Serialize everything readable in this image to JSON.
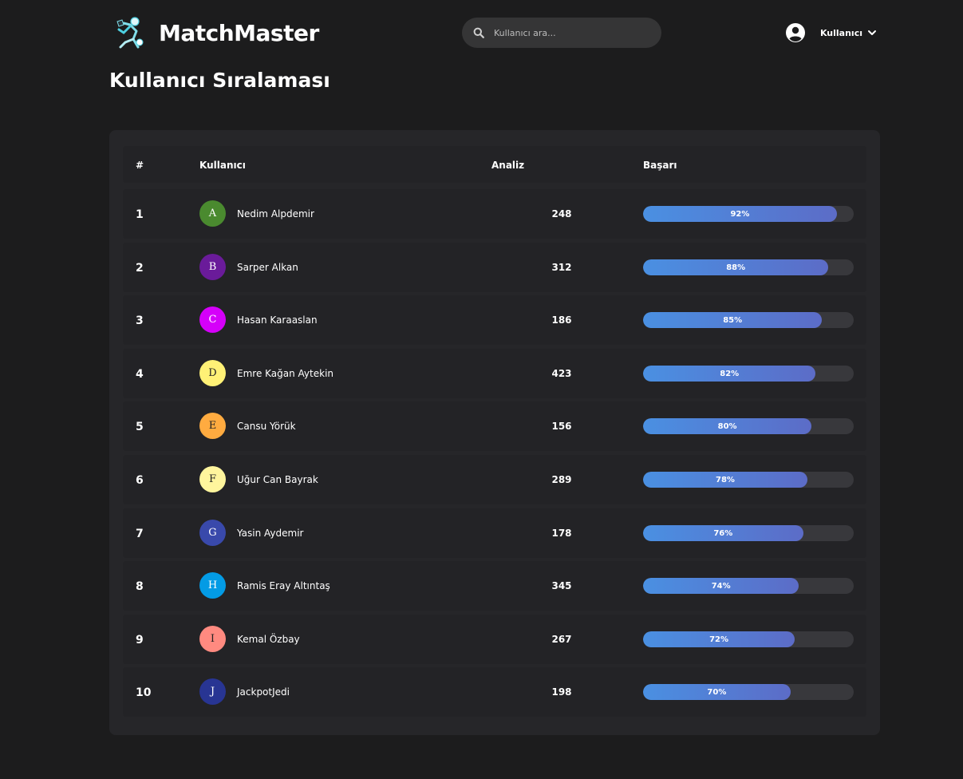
{
  "header": {
    "brand": "MatchMaster",
    "search_placeholder": "Kullanıcı ara...",
    "user_label": "Kullanıcı"
  },
  "page_title": "Kullanıcı Sıralaması",
  "table": {
    "columns": {
      "rank": "#",
      "user": "Kullanıcı",
      "analiz": "Analiz",
      "basari": "Başarı"
    },
    "rows": [
      {
        "rank": "1",
        "initial": "A",
        "avatar_color": "#4a8a2f",
        "avatar_text_color": "#ffffff",
        "name": "Nedim Alpdemir",
        "analiz": "248",
        "basari": "92%",
        "basari_value": 0.92
      },
      {
        "rank": "2",
        "initial": "B",
        "avatar_color": "#6a1b9a",
        "avatar_text_color": "#ffffff",
        "name": "Sarper Alkan",
        "analiz": "312",
        "basari": "88%",
        "basari_value": 0.88
      },
      {
        "rank": "3",
        "initial": "C",
        "avatar_color": "#d500f9",
        "avatar_text_color": "#ffffff",
        "name": "Hasan Karaaslan",
        "analiz": "186",
        "basari": "85%",
        "basari_value": 0.85
      },
      {
        "rank": "4",
        "initial": "D",
        "avatar_color": "#fff176",
        "avatar_text_color": "#222222",
        "name": "Emre Kağan Aytekin",
        "analiz": "423",
        "basari": "82%",
        "basari_value": 0.82
      },
      {
        "rank": "5",
        "initial": "E",
        "avatar_color": "#ffab40",
        "avatar_text_color": "#222222",
        "name": "Cansu Yörük",
        "analiz": "156",
        "basari": "80%",
        "basari_value": 0.8
      },
      {
        "rank": "6",
        "initial": "F",
        "avatar_color": "#fff59d",
        "avatar_text_color": "#222222",
        "name": "Uğur Can Bayrak",
        "analiz": "289",
        "basari": "78%",
        "basari_value": 0.78
      },
      {
        "rank": "7",
        "initial": "G",
        "avatar_color": "#3949ab",
        "avatar_text_color": "#ffffff",
        "name": "Yasin Aydemir",
        "analiz": "178",
        "basari": "76%",
        "basari_value": 0.76
      },
      {
        "rank": "8",
        "initial": "H",
        "avatar_color": "#039be5",
        "avatar_text_color": "#ffffff",
        "name": "Ramis Eray Altıntaş",
        "analiz": "345",
        "basari": "74%",
        "basari_value": 0.74
      },
      {
        "rank": "9",
        "initial": "I",
        "avatar_color": "#ff8a80",
        "avatar_text_color": "#222222",
        "name": "Kemal Özbay",
        "analiz": "267",
        "basari": "72%",
        "basari_value": 0.72
      },
      {
        "rank": "10",
        "initial": "J",
        "avatar_color": "#283593",
        "avatar_text_color": "#ffffff",
        "name": "JackpotJedi",
        "analiz": "198",
        "basari": "70%",
        "basari_value": 0.7
      }
    ]
  },
  "colors": {
    "background": "#1c1c1d",
    "card": "#262629",
    "bar_start": "#4a90e2",
    "bar_end": "#5c6cc7"
  },
  "icons": {
    "logo": "soccer-player-logo-icon",
    "search": "search-icon",
    "user": "user-circle-icon",
    "chevron": "chevron-down-icon"
  }
}
